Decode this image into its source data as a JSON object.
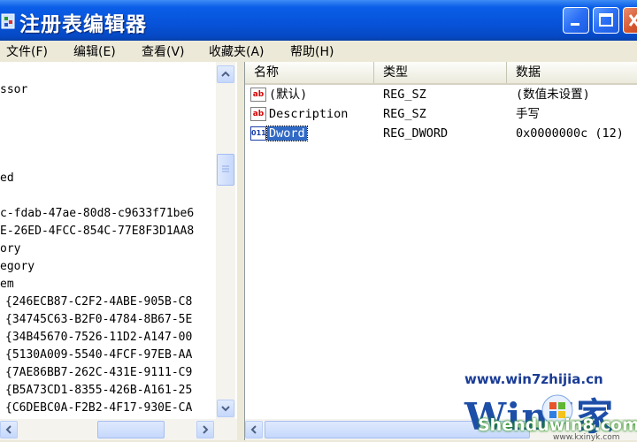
{
  "window": {
    "title": "注册表编辑器"
  },
  "menu": [
    "文件(F)",
    "编辑(E)",
    "查看(V)",
    "收藏夹(A)",
    "帮助(H)"
  ],
  "tree_lines": [
    "ssor",
    "",
    "",
    "",
    "",
    "ed",
    "",
    "c-fdab-47ae-80d8-c9633f71be6",
    "E-26ED-4FCC-854C-77E8F3D1AA8",
    "ory",
    "egory",
    "em",
    "{246ECB87-C2F2-4ABE-905B-C8",
    "{34745C63-B2F0-4784-8B67-5E",
    "{34B45670-7526-11D2-A147-00",
    "{5130A009-5540-4FCF-97EB-AA",
    "{7AE86BB7-262C-431E-9111-C9",
    "{B5A73CD1-8355-426B-A161-25",
    "{C6DEBC0A-F2B2-4F17-930E-CA"
  ],
  "list": {
    "columns": [
      "名称",
      "类型",
      "数据"
    ],
    "rows": [
      {
        "icon": "string-value-icon",
        "name": "(默认)",
        "type": "REG_SZ",
        "data": "(数值未设置)",
        "selected": false
      },
      {
        "icon": "string-value-icon",
        "name": "Description",
        "type": "REG_SZ",
        "data": "手写",
        "selected": false
      },
      {
        "icon": "dword-value-icon",
        "name": "Dword",
        "type": "REG_DWORD",
        "data": "0x0000000c (12)",
        "selected": true
      }
    ]
  },
  "watermark": {
    "url": "www.win7zhijia.cn",
    "logo": "Win7家",
    "site": "Shenduwin8.com",
    "sub": "www.kxinyk.com"
  },
  "colors": {
    "title_bar": "#0752d8",
    "selection": "#316ac5",
    "window_bg": "#ece9d8"
  }
}
